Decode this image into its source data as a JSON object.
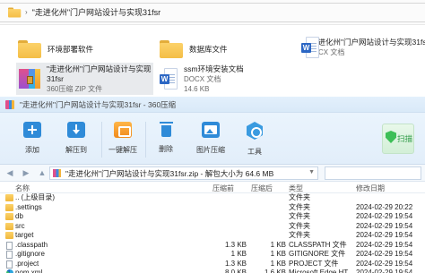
{
  "explorer": {
    "address_path": "\"走进化州\"门户网站设计与实现31fsr",
    "files": [
      {
        "name": "环境部署软件",
        "desc": "",
        "icon": "folder-icon"
      },
      {
        "name": "数据库文件",
        "desc": "",
        "icon": "folder-icon"
      },
      {
        "name": "\"走进化州\"门户网站设计与实现31fsr",
        "desc": "DOCX 文档",
        "icon": "word-doc-icon"
      },
      {
        "name": "\"走进化州\"门户网站设计与实现",
        "name2": "31fsr",
        "desc": "360压缩 ZIP 文件",
        "icon": "zip-archive-icon"
      },
      {
        "name": "ssm环境安装文档",
        "desc": "DOCX 文档",
        "size": "14.6 KB",
        "icon": "word-doc-icon"
      }
    ]
  },
  "zip_window": {
    "title": "\"走进化州\"门户网站设计与实现31fsr - 360压缩",
    "toolbar": [
      {
        "label": "添加",
        "icon": "add-icon"
      },
      {
        "label": "解压到",
        "icon": "extract-icon"
      },
      {
        "label": "一键解压",
        "icon": "one-click-extract-icon"
      },
      {
        "label": "删除",
        "icon": "delete-icon"
      },
      {
        "label": "图片压缩",
        "icon": "image-compress-icon"
      },
      {
        "label": "工具",
        "icon": "tools-icon"
      }
    ],
    "scan_label": "扫描",
    "path_text": "\"走进化州\"门户网站设计与实现31fsr.zip - 解包大小为 64.6 MB",
    "columns": {
      "name": "名称",
      "size": "压缩前",
      "compressed": "压缩后",
      "type": "类型",
      "modified": "修改日期"
    },
    "rows": [
      {
        "name": ".. (上级目录)",
        "size": "",
        "compressed": "",
        "type": "文件夹",
        "modified": "",
        "icon": "folder"
      },
      {
        "name": ".settings",
        "size": "",
        "compressed": "",
        "type": "文件夹",
        "modified": "2024-02-29 20:22",
        "icon": "folder"
      },
      {
        "name": "db",
        "size": "",
        "compressed": "",
        "type": "文件夹",
        "modified": "2024-02-29 19:54",
        "icon": "folder"
      },
      {
        "name": "src",
        "size": "",
        "compressed": "",
        "type": "文件夹",
        "modified": "2024-02-29 19:54",
        "icon": "folder"
      },
      {
        "name": "target",
        "size": "",
        "compressed": "",
        "type": "文件夹",
        "modified": "2024-02-29 19:54",
        "icon": "folder"
      },
      {
        "name": ".classpath",
        "size": "1.3 KB",
        "compressed": "1 KB",
        "type": "CLASSPATH 文件",
        "modified": "2024-02-29 19:54",
        "icon": "file"
      },
      {
        "name": ".gitignore",
        "size": "1 KB",
        "compressed": "1 KB",
        "type": "GITIGNORE 文件",
        "modified": "2024-02-29 19:54",
        "icon": "file"
      },
      {
        "name": ".project",
        "size": "1.3 KB",
        "compressed": "1 KB",
        "type": "PROJECT 文件",
        "modified": "2024-02-29 19:54",
        "icon": "file"
      },
      {
        "name": "pom.xml",
        "size": "8.0 KB",
        "compressed": "1.6 KB",
        "type": "Microsoft Edge HT...",
        "modified": "2024-02-29 19:54",
        "icon": "edge"
      }
    ]
  }
}
